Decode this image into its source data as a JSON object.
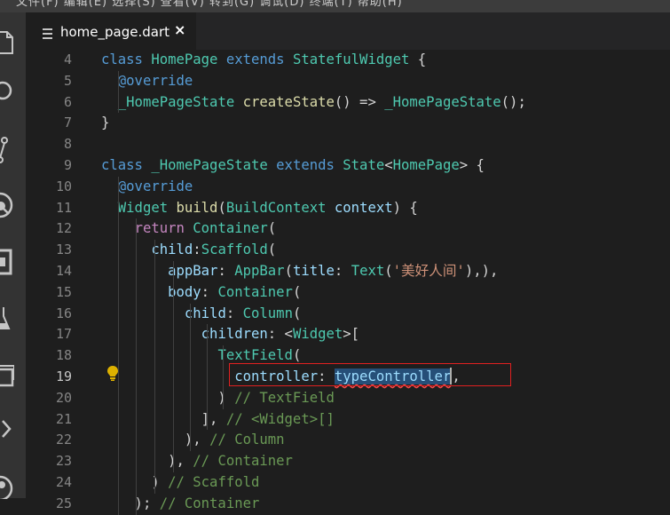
{
  "menubar": {
    "menus_text": "文件(F)   编辑(E)   选择(S)   查看(V)   转到(G)   调试(D)   终端(T)   帮助(H)",
    "min_glyph": "—"
  },
  "activity_bar": {
    "icons": [
      "explorer-icon",
      "search-icon",
      "source-control-icon",
      "debug-icon",
      "extensions-icon",
      "test-icon",
      "remote-icon",
      "chevron-right-icon",
      "account-icon"
    ]
  },
  "tab": {
    "filename": "home_page.dart",
    "close_glyph": "×"
  },
  "editor": {
    "line_numbers": [
      "4",
      "5",
      "6",
      "7",
      "8",
      "9",
      "10",
      "11",
      "12",
      "13",
      "14",
      "15",
      "16",
      "17",
      "18",
      "19",
      "20",
      "21",
      "22",
      "23",
      "24",
      "25"
    ],
    "active_line": "19",
    "lines": [
      [
        [
          "k",
          "class "
        ],
        [
          "t",
          "HomePage "
        ],
        [
          "k",
          "extends "
        ],
        [
          "t",
          "StatefulWidget "
        ],
        [
          "p",
          "{"
        ]
      ],
      [
        [
          "p",
          "  "
        ],
        [
          "k",
          "@override"
        ]
      ],
      [
        [
          "p",
          "  "
        ],
        [
          "t",
          "_HomePageState "
        ],
        [
          "f",
          "createState"
        ],
        [
          "p",
          "() => "
        ],
        [
          "t",
          "_HomePageState"
        ],
        [
          "p",
          "();"
        ]
      ],
      [
        [
          "p",
          "}"
        ]
      ],
      [],
      [
        [
          "k",
          "class "
        ],
        [
          "t",
          "_HomePageState "
        ],
        [
          "k",
          "extends "
        ],
        [
          "t",
          "State"
        ],
        [
          "p",
          "<"
        ],
        [
          "t",
          "HomePage"
        ],
        [
          "p",
          "> {"
        ]
      ],
      [
        [
          "p",
          "  "
        ],
        [
          "k",
          "@override"
        ]
      ],
      [
        [
          "p",
          "  "
        ],
        [
          "t",
          "Widget "
        ],
        [
          "f",
          "build"
        ],
        [
          "p",
          "("
        ],
        [
          "t",
          "BuildContext "
        ],
        [
          "v",
          "context"
        ],
        [
          "p",
          ") {"
        ]
      ],
      [
        [
          "p",
          "    "
        ],
        [
          "r",
          "return "
        ],
        [
          "t",
          "Container"
        ],
        [
          "p",
          "("
        ]
      ],
      [
        [
          "p",
          "      "
        ],
        [
          "v",
          "child"
        ],
        [
          "p",
          ":"
        ],
        [
          "t",
          "Scaffold"
        ],
        [
          "p",
          "("
        ]
      ],
      [
        [
          "p",
          "        "
        ],
        [
          "v",
          "appBar"
        ],
        [
          "p",
          ": "
        ],
        [
          "t",
          "AppBar"
        ],
        [
          "p",
          "("
        ],
        [
          "v",
          "title"
        ],
        [
          "p",
          ": "
        ],
        [
          "t",
          "Text"
        ],
        [
          "p",
          "("
        ],
        [
          "s",
          "'美好人间'"
        ],
        [
          "p",
          "),),"
        ]
      ],
      [
        [
          "p",
          "        "
        ],
        [
          "v",
          "body"
        ],
        [
          "p",
          ": "
        ],
        [
          "t",
          "Container"
        ],
        [
          "p",
          "("
        ]
      ],
      [
        [
          "p",
          "          "
        ],
        [
          "v",
          "child"
        ],
        [
          "p",
          ": "
        ],
        [
          "t",
          "Column"
        ],
        [
          "p",
          "("
        ]
      ],
      [
        [
          "p",
          "            "
        ],
        [
          "v",
          "children"
        ],
        [
          "p",
          ": <"
        ],
        [
          "t",
          "Widget"
        ],
        [
          "p",
          ">["
        ]
      ],
      [
        [
          "p",
          "              "
        ],
        [
          "t",
          "TextField"
        ],
        [
          "p",
          "("
        ]
      ],
      [
        [
          "p",
          "                "
        ],
        [
          "v",
          "controller"
        ],
        [
          "p",
          ": "
        ],
        [
          "sel",
          "typeController"
        ],
        [
          "cur",
          ""
        ],
        [
          "p",
          ","
        ]
      ],
      [
        [
          "p",
          "              ) "
        ],
        [
          "c",
          "// TextField"
        ]
      ],
      [
        [
          "p",
          "            ], "
        ],
        [
          "c",
          "// <Widget>[]"
        ]
      ],
      [
        [
          "p",
          "          ), "
        ],
        [
          "c",
          "// Column"
        ]
      ],
      [
        [
          "p",
          "        ), "
        ],
        [
          "c",
          "// Container"
        ]
      ],
      [
        [
          "p",
          "      ) "
        ],
        [
          "c",
          "// Scaffold"
        ]
      ],
      [
        [
          "p",
          "    ); "
        ],
        [
          "c",
          "// Container"
        ]
      ]
    ]
  }
}
